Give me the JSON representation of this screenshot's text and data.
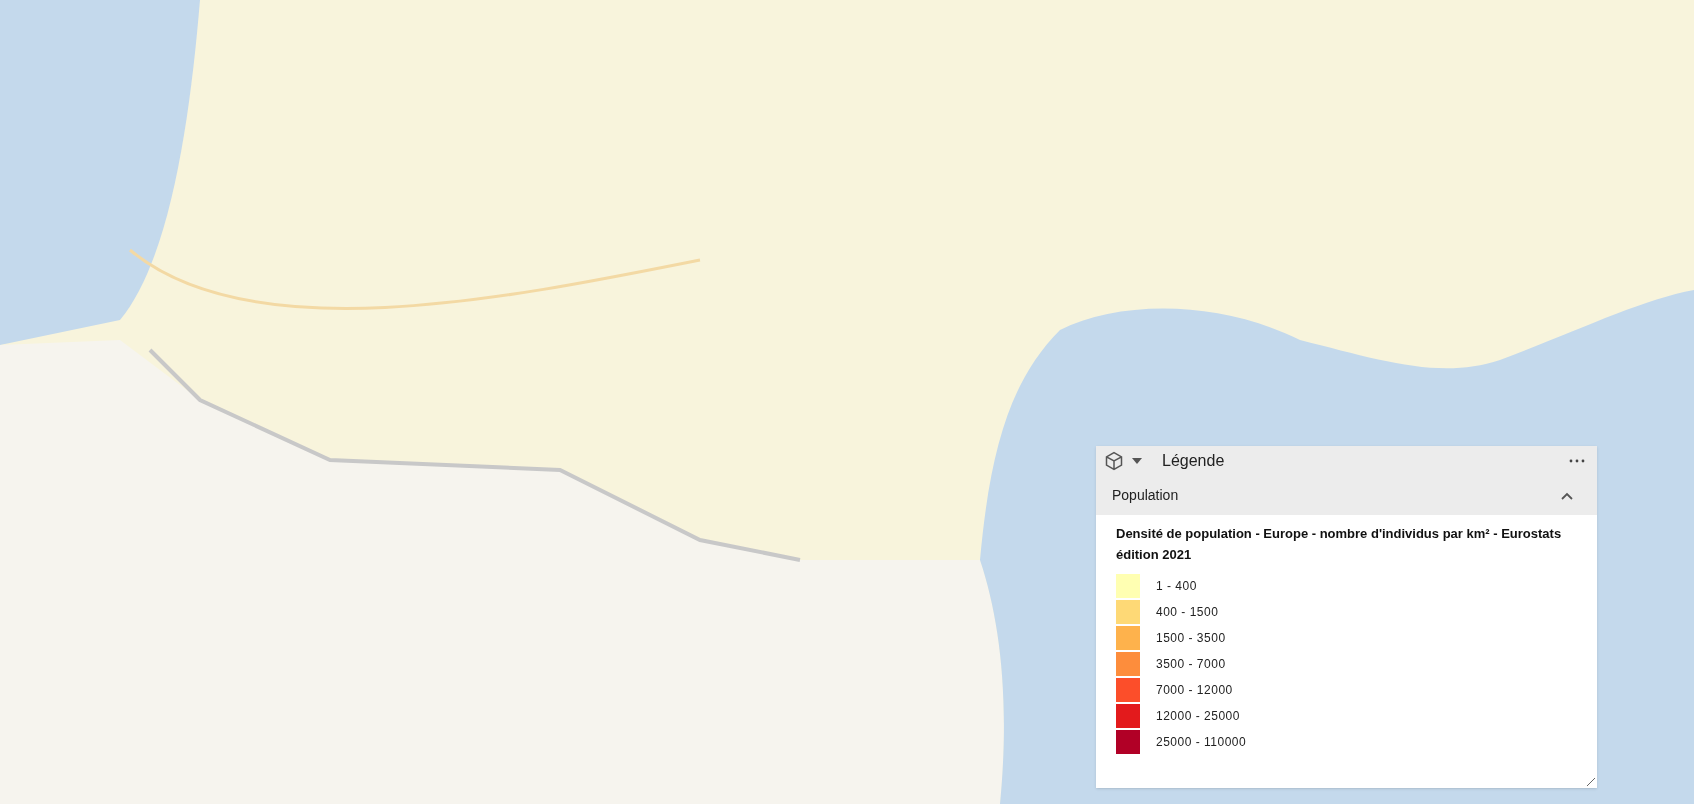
{
  "legend": {
    "title": "Légende",
    "section": {
      "label": "Population",
      "expanded": true,
      "heading": "Densité de population - Europe - nombre d'individus par km² - Eurostats édition 2021",
      "classes": [
        {
          "label": "1 - 400",
          "color": "#ffffb2"
        },
        {
          "label": "400 - 1500",
          "color": "#fed976"
        },
        {
          "label": "1500 - 3500",
          "color": "#feb24c"
        },
        {
          "label": "3500 - 7000",
          "color": "#fd8d3c"
        },
        {
          "label": "7000 - 12000",
          "color": "#fc4e2a"
        },
        {
          "label": "12000 - 25000",
          "color": "#e31a1c"
        },
        {
          "label": "25000 - 110000",
          "color": "#b10026"
        }
      ]
    }
  }
}
